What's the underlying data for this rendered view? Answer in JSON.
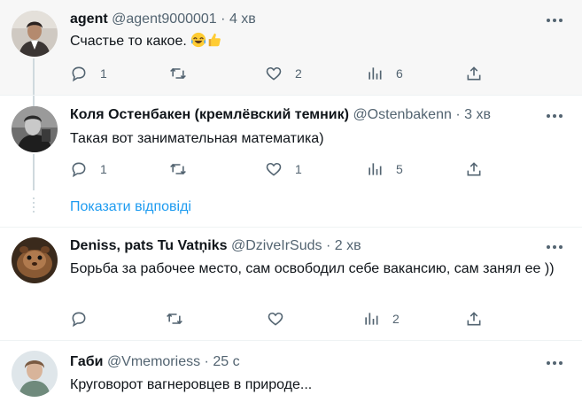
{
  "tweets": [
    {
      "name": "agent",
      "handle": "@agent9000001",
      "sep": "·",
      "time": "4 хв",
      "text": "Счастье то какое. ",
      "emojis": [
        "laughing-tears-emoji",
        "thumbs-up-emoji"
      ],
      "replies": "1",
      "likes": "2",
      "views": "6"
    },
    {
      "name": "Коля Остенбакен (кремлёвский темник)",
      "handle": "@Ostenbakenn",
      "sep": "·",
      "time": "3 хв",
      "text": "Такая вот занимательная математика)",
      "replies": "1",
      "likes": "1",
      "views": "5"
    },
    {
      "name": "Deniss, pats Tu Vatņiks",
      "handle": "@DziveIrSuds",
      "sep": "·",
      "time": "2 хв",
      "text": "Борьба за рабочее место, сам освободил себе вакансию, сам занял ее ))",
      "views": "2"
    },
    {
      "name": "Габи",
      "handle": "@Vmemoriess",
      "sep": "·",
      "time": "25 с",
      "text": "Круговорот вагнеровцев в природе..."
    }
  ],
  "show_replies": "Показати відповіді",
  "colors": {
    "accent": "#1d9bf0",
    "muted": "#536471",
    "thread": "#cfd9de"
  }
}
